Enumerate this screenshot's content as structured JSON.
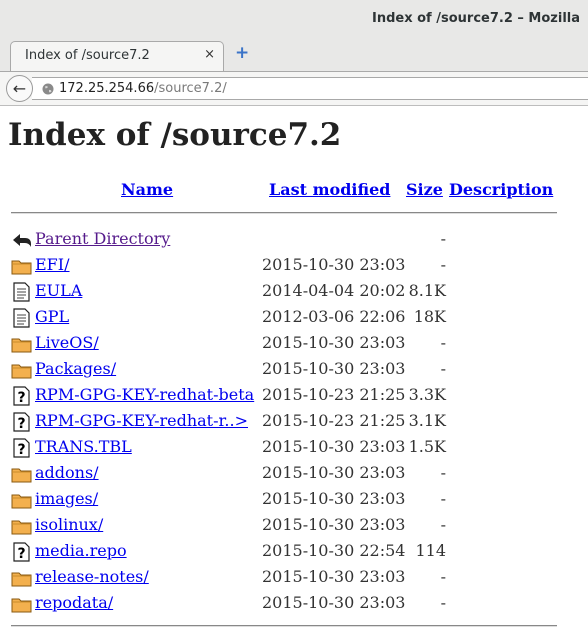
{
  "window": {
    "title": "Index of /source7.2 – Mozilla"
  },
  "tabs": [
    {
      "label": "Index of /source7.2",
      "close": "×"
    }
  ],
  "new_tab": "+",
  "nav": {
    "back": "←",
    "url_host": "172.25.254.66",
    "url_path": "/source7.2/"
  },
  "page": {
    "heading": "Index of /source7.2",
    "columns": {
      "name": "Name",
      "modified": "Last modified",
      "size": "Size",
      "description": "Description"
    },
    "rows": [
      {
        "icon": "back-icon",
        "name": "Parent Directory",
        "modified": "",
        "size": "-"
      },
      {
        "icon": "folder-icon",
        "name": "EFI/",
        "modified": "2015-10-30 23:03",
        "size": "-"
      },
      {
        "icon": "text-file-icon",
        "name": "EULA",
        "modified": "2014-04-04 20:02",
        "size": "8.1K"
      },
      {
        "icon": "text-file-icon",
        "name": "GPL",
        "modified": "2012-03-06 22:06",
        "size": "18K"
      },
      {
        "icon": "folder-icon",
        "name": "LiveOS/",
        "modified": "2015-10-30 23:03",
        "size": "-"
      },
      {
        "icon": "folder-icon",
        "name": "Packages/",
        "modified": "2015-10-30 23:03",
        "size": "-"
      },
      {
        "icon": "unknown-file-icon",
        "name": "RPM-GPG-KEY-redhat-beta",
        "modified": "2015-10-23 21:25",
        "size": "3.3K"
      },
      {
        "icon": "unknown-file-icon",
        "name": "RPM-GPG-KEY-redhat-r..>",
        "modified": "2015-10-23 21:25",
        "size": "3.1K"
      },
      {
        "icon": "unknown-file-icon",
        "name": "TRANS.TBL",
        "modified": "2015-10-30 23:03",
        "size": "1.5K"
      },
      {
        "icon": "folder-icon",
        "name": "addons/",
        "modified": "2015-10-30 23:03",
        "size": "-"
      },
      {
        "icon": "folder-icon",
        "name": "images/",
        "modified": "2015-10-30 23:03",
        "size": "-"
      },
      {
        "icon": "folder-icon",
        "name": "isolinux/",
        "modified": "2015-10-30 23:03",
        "size": "-"
      },
      {
        "icon": "unknown-file-icon",
        "name": "media.repo",
        "modified": "2015-10-30 22:54",
        "size": "114"
      },
      {
        "icon": "folder-icon",
        "name": "release-notes/",
        "modified": "2015-10-30 23:03",
        "size": "-"
      },
      {
        "icon": "folder-icon",
        "name": "repodata/",
        "modified": "2015-10-30 23:03",
        "size": "-"
      }
    ]
  }
}
